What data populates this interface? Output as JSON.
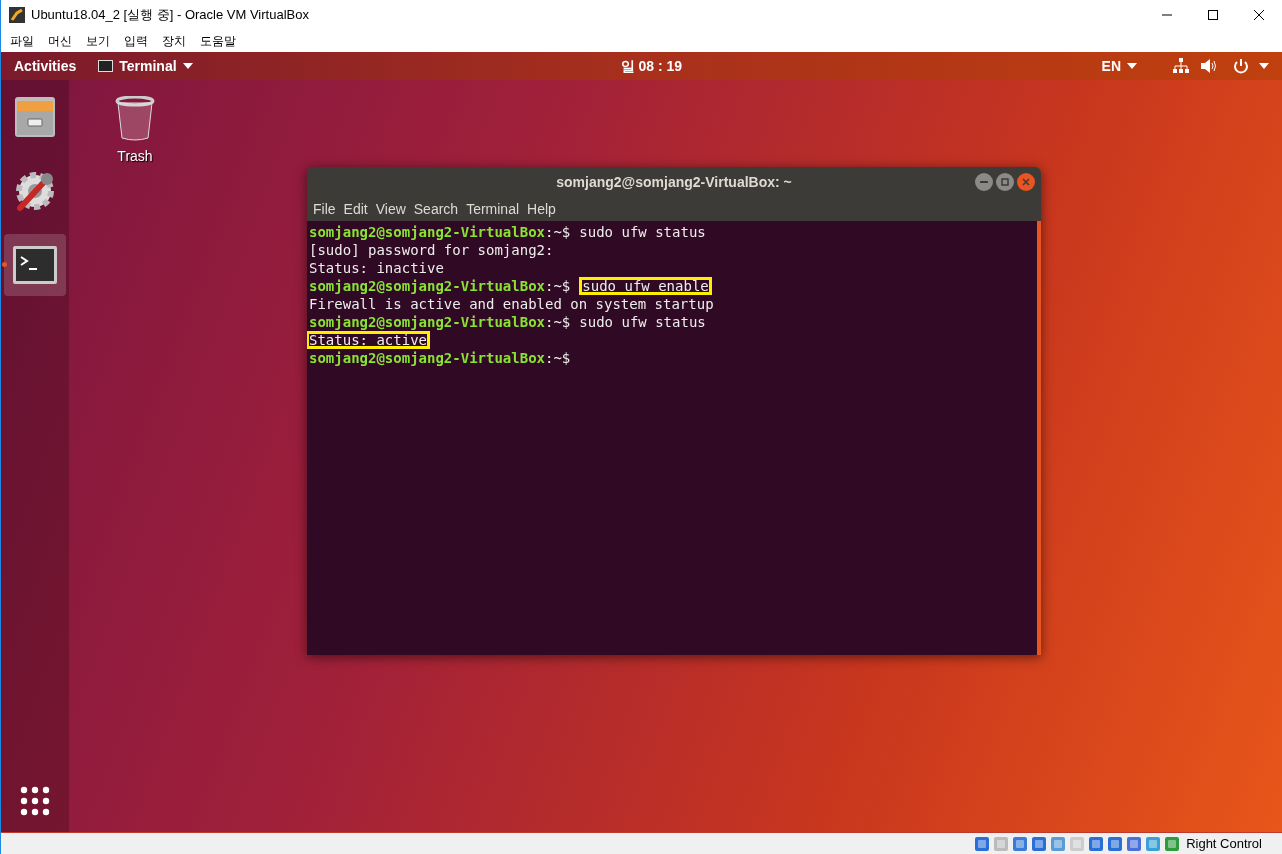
{
  "host_window": {
    "title": "Ubuntu18.04_2 [실행 중] - Oracle VM VirtualBox",
    "menu": [
      "파일",
      "머신",
      "보기",
      "입력",
      "장치",
      "도움말"
    ]
  },
  "top_bar": {
    "activities": "Activities",
    "app_menu": "Terminal",
    "clock": "일 08 : 19",
    "input_source": "EN"
  },
  "dock": [
    {
      "kind": "files",
      "running": false
    },
    {
      "kind": "settings",
      "running": false
    },
    {
      "kind": "terminal",
      "running": true
    }
  ],
  "desktop_icons": [
    {
      "label": "Trash"
    }
  ],
  "terminal": {
    "title": "somjang2@somjang2-VirtualBox: ~",
    "menu": [
      "File",
      "Edit",
      "View",
      "Search",
      "Terminal",
      "Help"
    ],
    "lines": [
      {
        "kind": "prompt",
        "user_host": "somjang2@somjang2-VirtualBox",
        "path": ":~$",
        "command": "sudo ufw status",
        "highlighted": false
      },
      {
        "kind": "output",
        "text": "[sudo] password for somjang2:",
        "highlighted": false
      },
      {
        "kind": "output",
        "text": "Status: inactive",
        "highlighted": false
      },
      {
        "kind": "prompt",
        "user_host": "somjang2@somjang2-VirtualBox",
        "path": ":~$",
        "command": "sudo ufw enable",
        "highlighted": true
      },
      {
        "kind": "output",
        "text": "Firewall is active and enabled on system startup",
        "highlighted": false
      },
      {
        "kind": "prompt",
        "user_host": "somjang2@somjang2-VirtualBox",
        "path": ":~$",
        "command": "sudo ufw status",
        "highlighted": false
      },
      {
        "kind": "output",
        "text": "Status: active",
        "highlighted": true
      },
      {
        "kind": "prompt",
        "user_host": "somjang2@somjang2-VirtualBox",
        "path": ":~$",
        "highlighted": false
      }
    ]
  },
  "status_bar": {
    "host_key": "Right Control"
  }
}
